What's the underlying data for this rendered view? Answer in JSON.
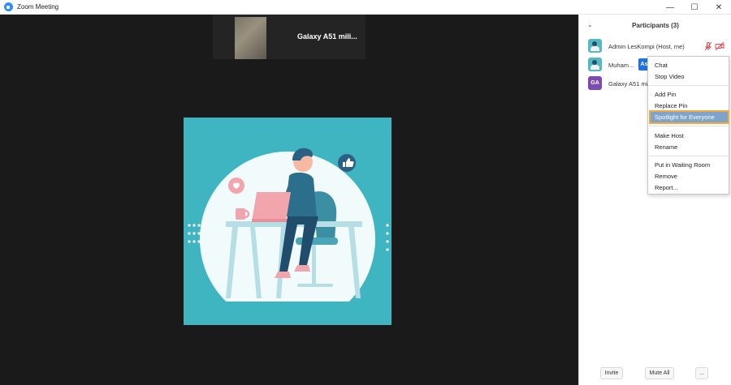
{
  "window": {
    "title": "Zoom Meeting",
    "controls": {
      "minimize": "—",
      "maximize": "☐",
      "close": "✕"
    }
  },
  "video": {
    "thumbnail_name": "Galaxy A51 mili..."
  },
  "sidebar": {
    "title": "Participants (3)",
    "collapse_icon": "chevron-down-icon",
    "participants": [
      {
        "name": "Admin LesKompi (Host, me)",
        "avatar": "image",
        "mic_muted": true,
        "video_off": true
      },
      {
        "name": "Muham...",
        "avatar": "image",
        "ask_label": "As",
        "more_label": "..."
      },
      {
        "name": "Galaxy A51 mili",
        "avatar_initials": "GA"
      }
    ],
    "footer": {
      "invite": "Invite",
      "mute_all": "Mute All",
      "more": "..."
    }
  },
  "context_menu": {
    "items": [
      {
        "label": "Chat"
      },
      {
        "label": "Stop Video"
      },
      {
        "label": "Add Pin"
      },
      {
        "label": "Replace Pin"
      },
      {
        "label": "Spotlight for Everyone",
        "highlighted": true
      },
      {
        "label": "Make Host"
      },
      {
        "label": "Rename"
      },
      {
        "label": "Put in Waiting Room"
      },
      {
        "label": "Remove"
      },
      {
        "label": "Report..."
      }
    ]
  },
  "colors": {
    "accent": "#2d8cff",
    "video_background": "#1a1a1a",
    "illustration_background": "#3fb5c1",
    "highlight": "#7fa4c9",
    "highlight_outline": "#f4a93e",
    "ask_button": "#1f72e6",
    "ga_avatar": "#7b4bb3",
    "muted_icon": "#e0474c"
  }
}
